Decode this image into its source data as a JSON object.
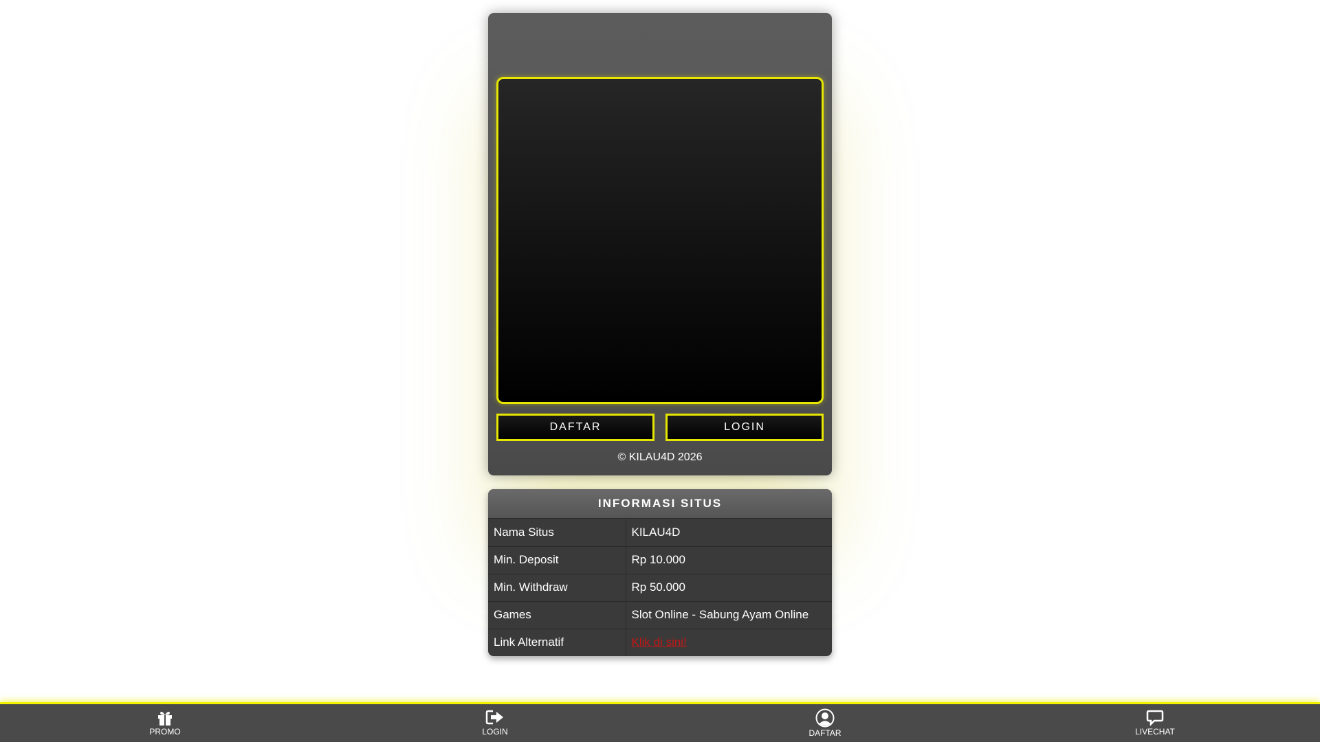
{
  "card": {
    "buttons": {
      "daftar": "DAFTAR",
      "login": "LOGIN"
    },
    "copyright": "© KILAU4D 2026"
  },
  "info": {
    "title": "INFORMASI SITUS",
    "rows": [
      {
        "key": "Nama Situs",
        "value": "KILAU4D"
      },
      {
        "key": "Min. Deposit",
        "value": "Rp 10.000"
      },
      {
        "key": "Min. Withdraw",
        "value": "Rp 50.000"
      },
      {
        "key": "Games",
        "value": "Slot Online - Sabung Ayam Online"
      },
      {
        "key": "Link Alternatif",
        "value": "Klik di sini!"
      }
    ]
  },
  "bottom_nav": {
    "items": [
      {
        "label": "PROMO",
        "icon": "gift-icon"
      },
      {
        "label": "LOGIN",
        "icon": "sign-in-icon"
      },
      {
        "label": "DAFTAR",
        "icon": "user-circle-icon"
      },
      {
        "label": "LIVECHAT",
        "icon": "chat-bubble-icon"
      }
    ]
  },
  "colors": {
    "accent_yellow": "#e6e600",
    "link_red": "#c41616",
    "panel_gray": "#555555",
    "nav_gray": "#4a4a4a"
  }
}
